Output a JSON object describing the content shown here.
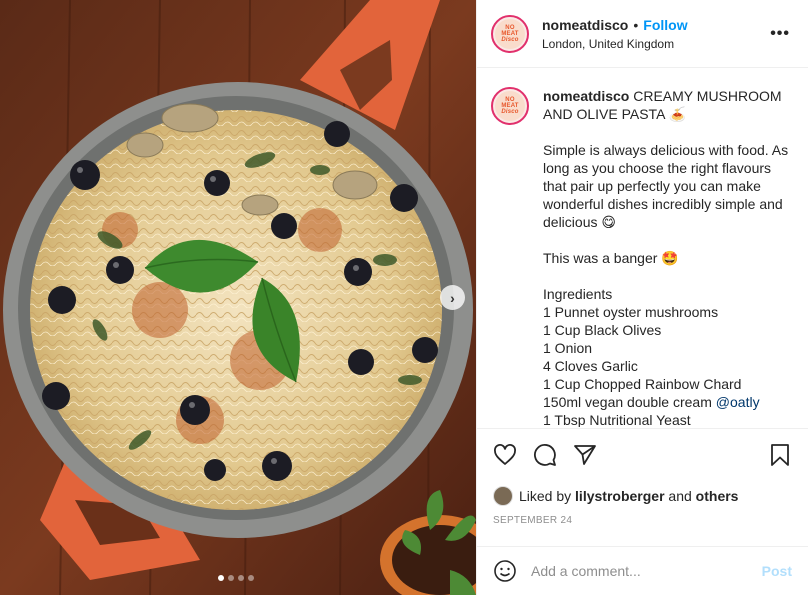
{
  "post": {
    "username": "nomeatdisco",
    "follow_label": "Follow",
    "separator": "•",
    "location": "London, United Kingdom",
    "more_label": "•••",
    "avatar_text": [
      "NO",
      "MEAT",
      "Disco"
    ],
    "next_label": "›",
    "carousel": {
      "count": 4,
      "active": 0
    }
  },
  "caption": {
    "title": "CREAMY MUSHROOM AND OLIVE PASTA 🍝",
    "intro": "Simple is always delicious with food. As long as you choose the right flavours that pair up perfectly you can make wonderful dishes incredibly simple and delicious 😋",
    "banger": "This was a banger 🤩",
    "ingredients_heading": "Ingredients",
    "ingredients": [
      "1 Punnet oyster mushrooms",
      "1 Cup Black Olives",
      "1 Onion",
      "4 Cloves Garlic",
      "1 Cup Chopped Rainbow Chard"
    ],
    "cream_line": "150ml vegan double cream ",
    "cream_mention": "@oatly",
    "yeast_line": "1 Tbsp Nutritional Yeast"
  },
  "likes": {
    "prefix": "Liked by ",
    "user": "lilystroberger",
    "middle": " and ",
    "others": "others"
  },
  "date": "SEPTEMBER 24",
  "comment": {
    "placeholder": "Add a comment...",
    "post_label": "Post"
  },
  "icons": {
    "like": "heart-icon",
    "comment": "comment-icon",
    "share": "paper-plane-icon",
    "save": "bookmark-icon",
    "emoji": "smiley-icon",
    "more": "more-options-icon",
    "next": "chevron-right-icon"
  },
  "colors": {
    "follow": "#0095f6",
    "post_disabled": "#b2dffc",
    "mention": "#00376b",
    "avatar_ring": "#e1306c",
    "secondary_text": "#8e8e8e"
  }
}
